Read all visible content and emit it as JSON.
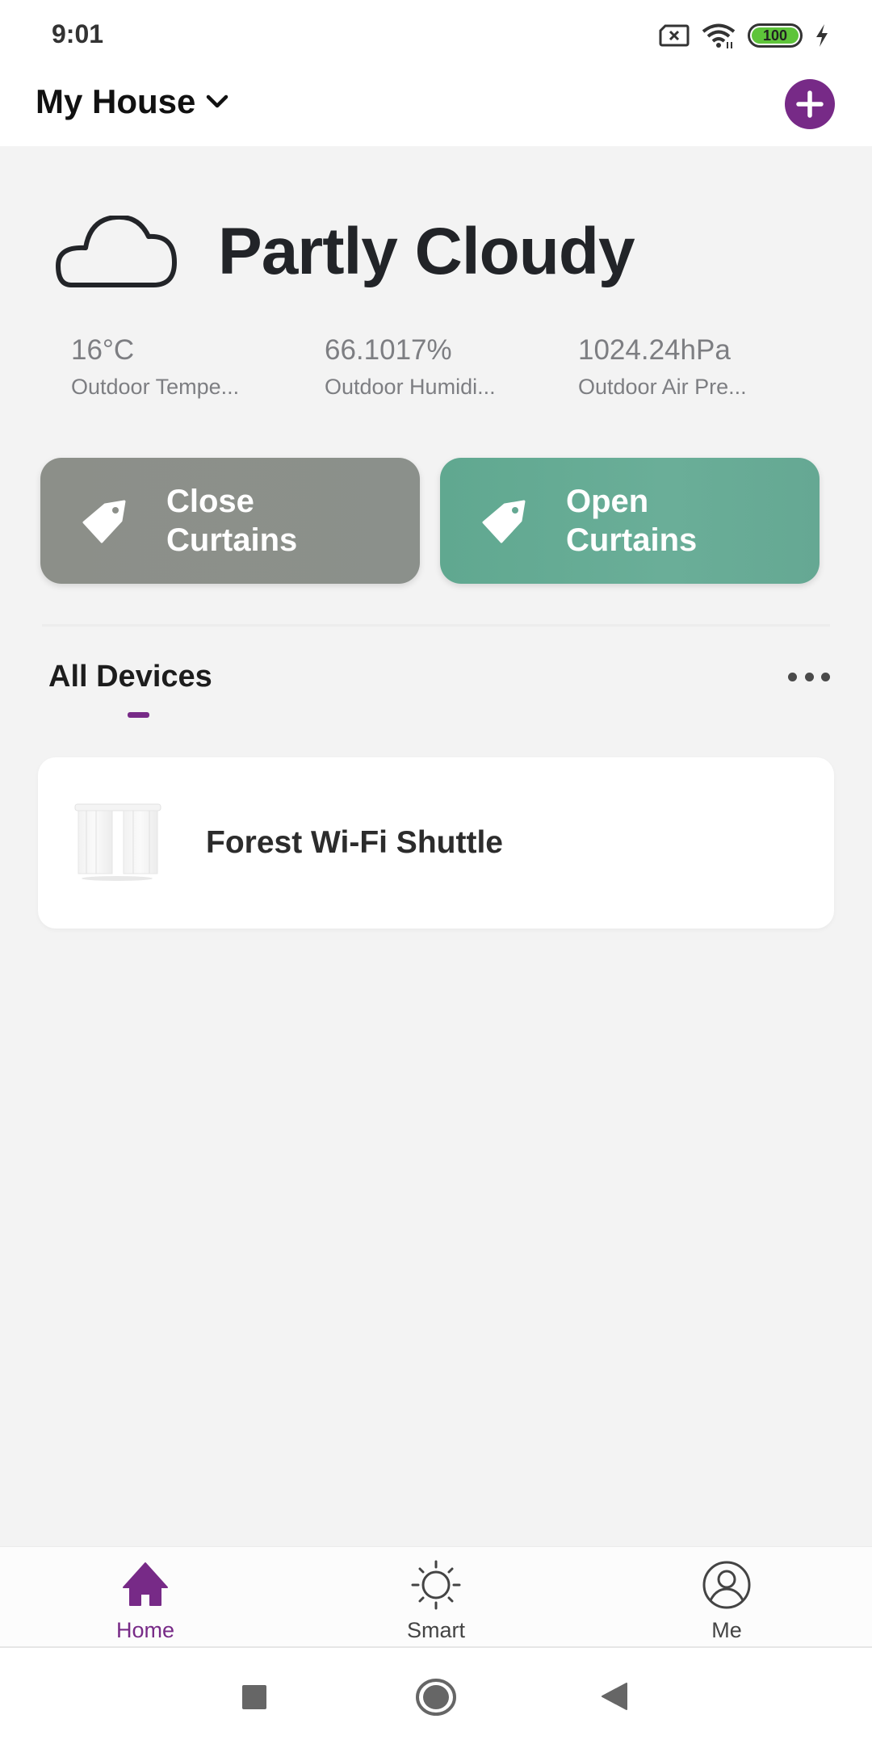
{
  "status_bar": {
    "time": "9:01",
    "battery": "100",
    "icons": [
      "no-sim-icon",
      "wifi-icon",
      "battery-icon",
      "charging-icon"
    ]
  },
  "header": {
    "house_name": "My House",
    "dropdown_icon": "chevron-down-icon",
    "add_icon": "plus-icon"
  },
  "weather": {
    "icon": "cloud-icon",
    "condition": "Partly Cloudy",
    "metrics": [
      {
        "value": "16°C",
        "label": "Outdoor Tempe..."
      },
      {
        "value": "66.1017%",
        "label": "Outdoor Humidi..."
      },
      {
        "value": "1024.24hPa",
        "label": "Outdoor Air Pre..."
      }
    ]
  },
  "scenes": [
    {
      "line1": "Close",
      "line2": "Curtains",
      "icon": "tag-icon",
      "color": "#8c8f89"
    },
    {
      "line1": "Open",
      "line2": "Curtains",
      "icon": "tag-icon",
      "color": "#65a893"
    }
  ],
  "devices_section": {
    "title": "All Devices",
    "more_icon": "more-horizontal-icon"
  },
  "devices": [
    {
      "name": "Forest Wi-Fi Shuttle",
      "icon": "curtain-icon"
    }
  ],
  "tab_bar": {
    "tabs": [
      {
        "label": "Home",
        "icon": "home-icon",
        "active": true
      },
      {
        "label": "Smart",
        "icon": "sun-icon",
        "active": false
      },
      {
        "label": "Me",
        "icon": "user-circle-icon",
        "active": false
      }
    ]
  },
  "colors": {
    "accent": "#772a87",
    "background": "#f3f3f3",
    "text_secondary": "#7d7e82"
  }
}
